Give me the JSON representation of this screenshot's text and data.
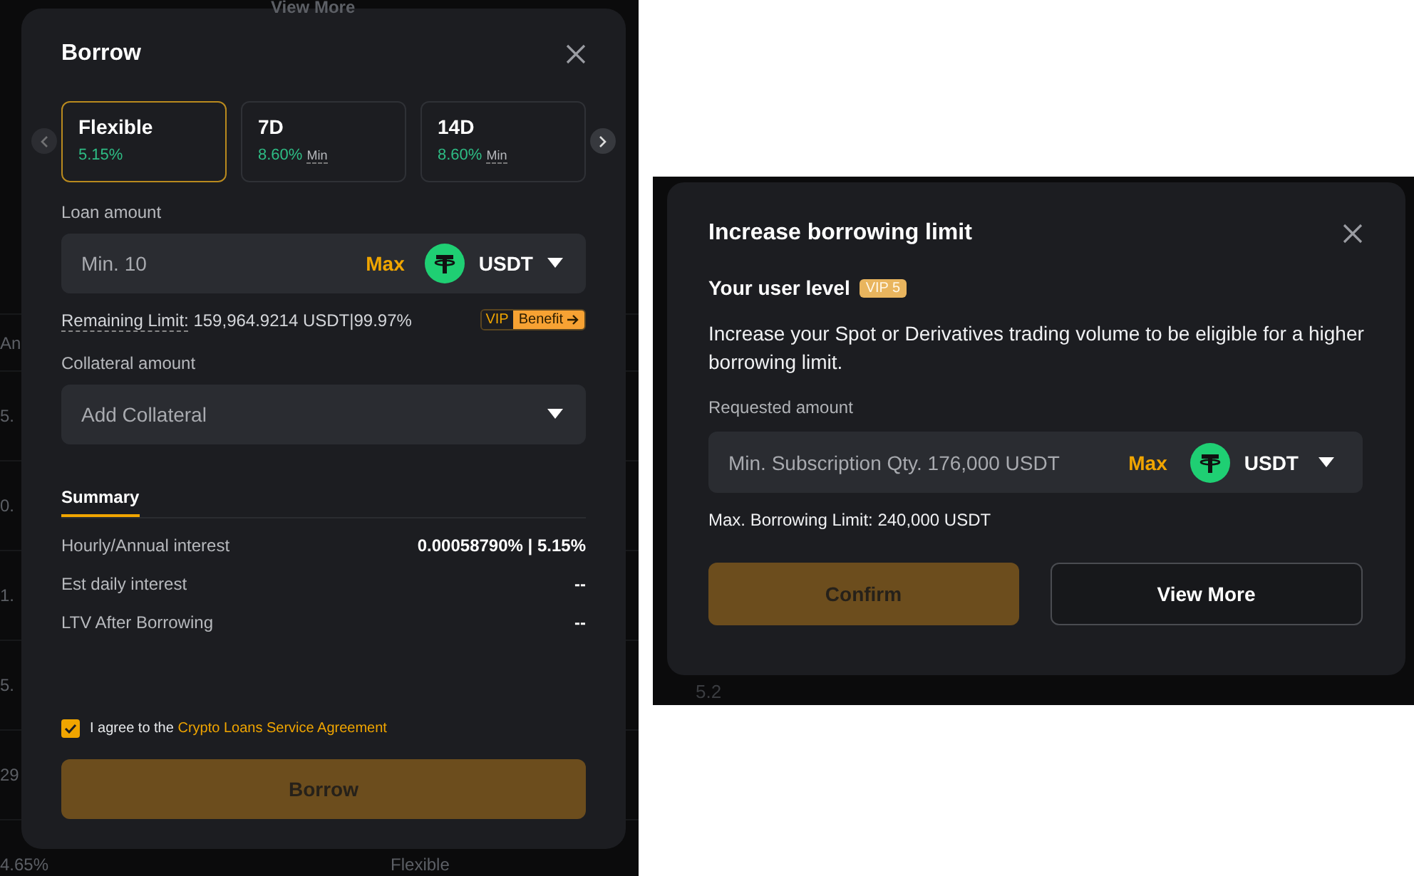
{
  "background": {
    "link": "View More",
    "rows": [
      {
        "column_1": "An"
      },
      {
        "column_1": "5."
      },
      {
        "column_1": "0."
      },
      {
        "column_1": "1."
      },
      {
        "column_1": "5."
      },
      {
        "column_1": "29"
      },
      {
        "column_1": "4.65%",
        "column_2": "Flexible"
      }
    ]
  },
  "borrow_dialog": {
    "title": "Borrow",
    "terms": [
      {
        "label": "Flexible",
        "rate": "5.15%",
        "selected": true
      },
      {
        "label": "7D",
        "rate": "8.60%",
        "suffix": "Min",
        "selected": false
      },
      {
        "label": "14D",
        "rate": "8.60%",
        "suffix": "Min",
        "selected": false
      }
    ],
    "loan_amount": {
      "label": "Loan amount",
      "placeholder": "Min. 10",
      "max": "Max",
      "currency": "USDT"
    },
    "remaining_label": "Remaining Limit:",
    "remaining_value": " 159,964.9214 USDT|99.97%",
    "vip_tag": "VIP",
    "benefit_tag": "Benefit",
    "collateral": {
      "label": "Collateral amount",
      "placeholder": "Add Collateral"
    },
    "summary_tab": "Summary",
    "summary_rows": [
      {
        "label": "Hourly/Annual interest",
        "value": "0.00058790% | 5.15%"
      },
      {
        "label": "Est daily interest",
        "value": "--"
      },
      {
        "label": "LTV After Borrowing",
        "value": "--"
      }
    ],
    "agreement": {
      "checked": true,
      "text": "I agree to the ",
      "link": "Crypto Loans Service Agreement"
    },
    "button": "Borrow"
  },
  "limit_background_text": "5.2",
  "limit_dialog": {
    "title": "Increase borrowing limit",
    "user_level_label": "Your user level",
    "vip_badge": "VIP 5",
    "description": "Increase your Spot or Derivatives trading volume to be eligible for a higher borrowing limit.",
    "requested": {
      "label": "Requested amount",
      "placeholder": "Min. Subscription Qty. 176,000 USDT",
      "max": "Max",
      "currency": "USDT"
    },
    "max_limit": "Max. Borrowing Limit: 240,000 USDT",
    "buttons": [
      {
        "label": "Confirm",
        "kind": "primary"
      },
      {
        "label": "View More",
        "kind": "outline"
      }
    ]
  }
}
